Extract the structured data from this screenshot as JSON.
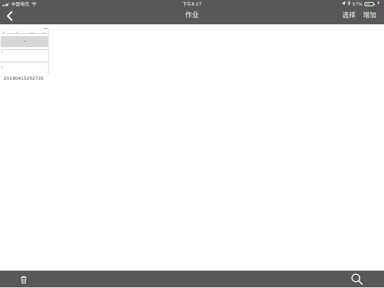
{
  "status_bar": {
    "carrier": "中国电信",
    "time": "下午8:27",
    "battery_percent": "57%",
    "battery_level": 0.57
  },
  "nav": {
    "title": "作业",
    "select_label": "选择",
    "add_label": "增加"
  },
  "documents": [
    {
      "name": "20190415202735"
    }
  ],
  "icons": {
    "back": "chevron-left-icon",
    "trash": "trash-icon",
    "search": "search-icon"
  }
}
